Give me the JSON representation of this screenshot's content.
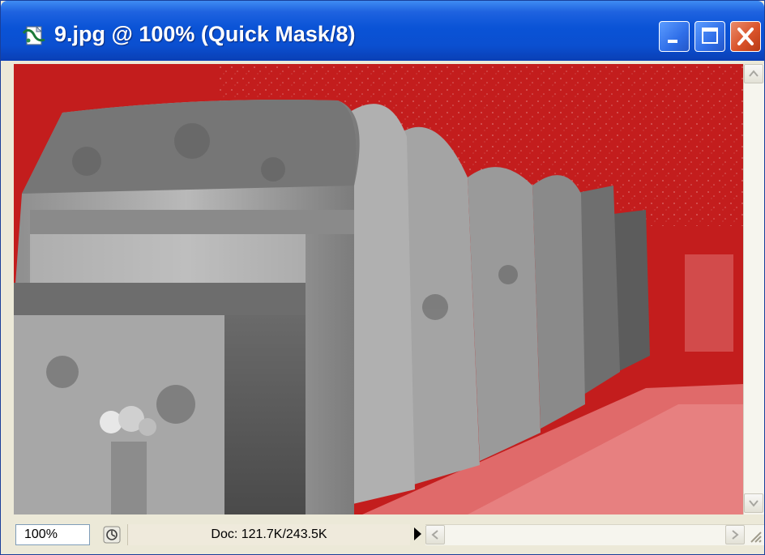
{
  "window": {
    "title": "9.jpg @ 100% (Quick Mask/8)",
    "icons": {
      "app": "photoshop-document-icon",
      "minimize": "minimize-icon",
      "maximize": "maximize-icon",
      "close": "close-icon"
    }
  },
  "canvas": {
    "mode": "Quick Mask",
    "mask_color": "#c31d1d",
    "image_subject": ""
  },
  "statusbar": {
    "zoom": "100%",
    "doc_info": "Doc: 121.7K/243.5K",
    "icons": {
      "status": "status-info-icon",
      "menu": "play-arrow-icon"
    }
  },
  "colors": {
    "titlebar": "#0a53d6",
    "close_button": "#d9532a",
    "quick_mask": "#c31d1d"
  }
}
